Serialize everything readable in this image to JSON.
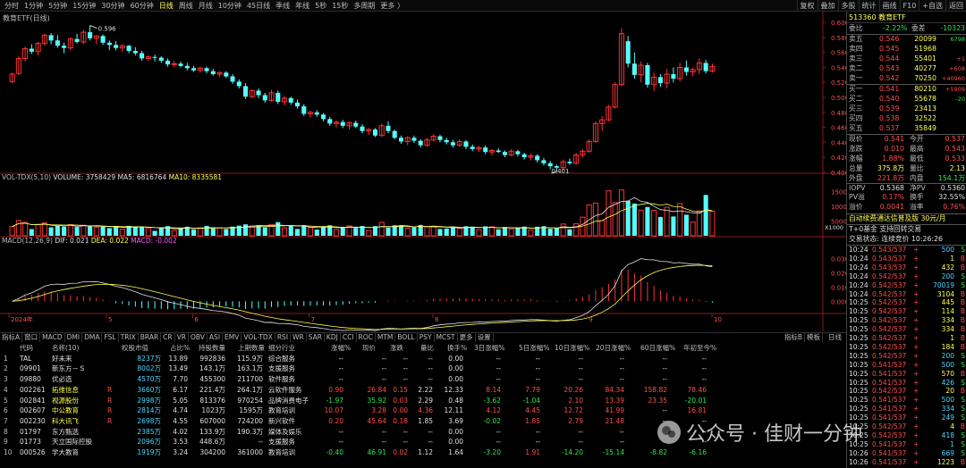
{
  "period_tabs": [
    "分时",
    "1分钟",
    "5分钟",
    "15分钟",
    "30分钟",
    "60分钟",
    "日线",
    "周线",
    "月线",
    "10分钟",
    "45日线",
    "季线",
    "年线",
    "5秒",
    "15秒",
    "多周期",
    "更多 〉"
  ],
  "active_period": "日线",
  "right_tools": [
    "复权",
    "叠加",
    "多股",
    "统计",
    "画线",
    "F10",
    "+自选",
    "返回"
  ],
  "chart_title": "教育ETF(日线)",
  "price_axis": [
    "0.600",
    "0.580",
    "0.560",
    "0.540",
    "0.520",
    "0.500",
    "0.480",
    "0.460",
    "0.440",
    "0.420",
    "0.400"
  ],
  "high_label": "0.596",
  "low_label": "0.401",
  "vol_legend": {
    "name": "VOL-TDX(5,10)",
    "volume": "VOLUME: 3758429",
    "ma5": "MA5: 6816764",
    "ma10": "MA10: 8335581"
  },
  "vol_axis": [
    "15000",
    "10000",
    "5000"
  ],
  "vol_unit": "X1000",
  "macd_legend": {
    "name": "MACD(12,26,9)",
    "dif": "DIF: 0.021",
    "dea": "DEA: 0.022",
    "macd": "MACD: -0.002"
  },
  "macd_axis": [
    "0.030",
    "0.020",
    "0.010",
    "0.000"
  ],
  "date_axis": [
    "2024年",
    "5",
    "6",
    "7",
    "8",
    "9",
    "10"
  ],
  "indicator_tabs": [
    "指标A",
    "窗口",
    "MACD",
    "DMI",
    "DMA",
    "FSL",
    "TRIX",
    "BRAR",
    "CR",
    "VR",
    "OBV",
    "ASI",
    "EMV",
    "VOL-TDX",
    "RSI",
    "WR",
    "SAR",
    "KDJ",
    "CCI",
    "ROC",
    "MTM",
    "BOLL",
    "PSY",
    "MCST",
    "更多",
    "设置"
  ],
  "indicator_right": [
    "指标B",
    "模板"
  ],
  "day_line_label": "日线",
  "table_headers": [
    "代码",
    "名称(10)",
    "",
    "权股市值",
    "占比%",
    "持股数量",
    "上期数量",
    "细分行业",
    "涨幅%",
    "现价",
    "涨跌",
    "量比",
    "换手%",
    "3日涨幅%",
    "5日涨幅%",
    "10日涨幅%",
    "20日涨幅%",
    "60日涨幅%",
    "年初至今%"
  ],
  "table_rows": [
    {
      "idx": "1",
      "code": "TAL",
      "name": "好未来",
      "r": "",
      "mv": "8237万",
      "pct": "13.89",
      "hold": "992836",
      "prev": "115.9万",
      "ind": "综合服务",
      "chg": "--",
      "price": "--",
      "diff": "--",
      "vr": "--",
      "to": "0.00",
      "d3": "--",
      "d5": "--",
      "d10": "--",
      "d20": "--",
      "d60": "--",
      "ytd": "--",
      "color": "white"
    },
    {
      "idx": "2",
      "code": "09901",
      "name": "新东方－Ｓ",
      "r": "",
      "mv": "8002万",
      "pct": "13.49",
      "hold": "143.1万",
      "prev": "163.1万",
      "ind": "支援服务",
      "chg": "--",
      "price": "--",
      "diff": "--",
      "vr": "--",
      "to": "0.00",
      "d3": "--",
      "d5": "--",
      "d10": "--",
      "d20": "--",
      "d60": "--",
      "ytd": "--",
      "color": "white"
    },
    {
      "idx": "3",
      "code": "09880",
      "name": "优必选",
      "r": "",
      "mv": "4570万",
      "pct": "7.70",
      "hold": "455300",
      "prev": "211700",
      "ind": "软件服务",
      "chg": "--",
      "price": "--",
      "diff": "--",
      "vr": "--",
      "to": "0.00",
      "d3": "--",
      "d5": "--",
      "d10": "--",
      "d20": "--",
      "d60": "--",
      "ytd": "--",
      "color": "white"
    },
    {
      "idx": "4",
      "code": "002261",
      "name": "拓维信息",
      "r": "R",
      "mv": "3660万",
      "pct": "6.17",
      "hold": "221.4万",
      "prev": "264.1万",
      "ind": "云软件服务",
      "chg": "0.90",
      "price": "26.84",
      "diff": "0.15",
      "vr": "2.22",
      "to": "12.33",
      "d3": "8.14",
      "d5": "7.79",
      "d10": "20.26",
      "d20": "84.34",
      "d60": "158.82",
      "ytd": "78.46",
      "color": "red"
    },
    {
      "idx": "5",
      "code": "002841",
      "name": "视源股份",
      "r": "R",
      "mv": "2998万",
      "pct": "5.05",
      "hold": "813376",
      "prev": "970254",
      "ind": "品牌消费电子",
      "chg": "-1.97",
      "price": "35.92",
      "diff": "0.03",
      "vr": "2.29",
      "to": "0.48",
      "d3": "-3.62",
      "d5": "-1.04",
      "d10": "2.10",
      "d20": "13.39",
      "d60": "23.35",
      "ytd": "-20.01",
      "color": "green"
    },
    {
      "idx": "6",
      "code": "002607",
      "name": "中公教育",
      "r": "R",
      "mv": "2814万",
      "pct": "4.74",
      "hold": "1023万",
      "prev": "1595万",
      "ind": "教育培训",
      "chg": "10.07",
      "price": "3.28",
      "diff": "0.00",
      "vr": "4.36",
      "to": "12.11",
      "d3": "4.12",
      "d5": "4.45",
      "d10": "12.72",
      "d20": "41.99",
      "d60": "--",
      "ytd": "16.81",
      "color": "red"
    },
    {
      "idx": "7",
      "code": "002230",
      "name": "科大讯飞",
      "r": "R",
      "mv": "2698万",
      "pct": "4.55",
      "hold": "607000",
      "prev": "724200",
      "ind": "新兴软件",
      "chg": "0.20",
      "price": "45.64",
      "diff": "0.18",
      "vr": "1.85",
      "to": "3.69",
      "d3": "-0.02",
      "d5": "1.85",
      "d10": "2.79",
      "d20": "21.48",
      "d60": "--",
      "ytd": "--",
      "color": "red"
    },
    {
      "idx": "8",
      "code": "01797",
      "name": "东方甄选",
      "r": "",
      "mv": "2385万",
      "pct": "4.02",
      "hold": "133.9万",
      "prev": "190.3万",
      "ind": "媒体及娱乐",
      "chg": "--",
      "price": "--",
      "diff": "--",
      "vr": "--",
      "to": "0.00",
      "d3": "--",
      "d5": "--",
      "d10": "--",
      "d20": "--",
      "d60": "--",
      "ytd": "--",
      "color": "white"
    },
    {
      "idx": "9",
      "code": "01773",
      "name": "天立国际控股",
      "r": "",
      "mv": "2096万",
      "pct": "3.53",
      "hold": "448.6万",
      "prev": "--",
      "ind": "支援服务",
      "chg": "--",
      "price": "--",
      "diff": "--",
      "vr": "--",
      "to": "0.00",
      "d3": "--",
      "d5": "--",
      "d10": "--",
      "d20": "--",
      "d60": "--",
      "ytd": "--",
      "color": "white"
    },
    {
      "idx": "10",
      "code": "000526",
      "name": "学大教育",
      "r": "",
      "mv": "1919万",
      "pct": "3.24",
      "hold": "304200",
      "prev": "361000",
      "ind": "教育培训",
      "chg": "-0.40",
      "price": "46.91",
      "diff": "0.02",
      "vr": "1.12",
      "to": "1.64",
      "d3": "-3.20",
      "d5": "1.91",
      "d10": "-14.20",
      "d20": "-15.14",
      "d60": "-8.82",
      "ytd": "-6.16",
      "color": "green"
    }
  ],
  "right_panel": {
    "code_name": "513360 教育ETF",
    "weibi_label": "委比",
    "weibi_val": "-2.22%",
    "weicha_label": "委差",
    "weicha_val": "-10323",
    "asks": [
      {
        "label": "卖五",
        "price": "0.546",
        "vol": "20099",
        "chg": "6798"
      },
      {
        "label": "卖四",
        "price": "0.545",
        "vol": "51968",
        "chg": ""
      },
      {
        "label": "卖三",
        "price": "0.544",
        "vol": "55401",
        "chg": "+1"
      },
      {
        "label": "卖二",
        "price": "0.543",
        "vol": "40277",
        "chg": "+608"
      },
      {
        "label": "卖一",
        "price": "0.542",
        "vol": "70250",
        "chg": "+40960"
      }
    ],
    "bids": [
      {
        "label": "买一",
        "price": "0.541",
        "vol": "80210",
        "chg": "+5909"
      },
      {
        "label": "买二",
        "price": "0.540",
        "vol": "55678",
        "chg": "-20"
      },
      {
        "label": "买三",
        "price": "0.539",
        "vol": "23413",
        "chg": ""
      },
      {
        "label": "买四",
        "price": "0.538",
        "vol": "32522",
        "chg": ""
      },
      {
        "label": "买五",
        "price": "0.537",
        "vol": "35849",
        "chg": ""
      }
    ],
    "quote": [
      {
        "l1": "现价",
        "v1": "0.541",
        "c1": "red",
        "l2": "今开",
        "v2": "0.537",
        "c2": "red"
      },
      {
        "l1": "涨跌",
        "v1": "0.010",
        "c1": "red",
        "l2": "最高",
        "v2": "0.543",
        "c2": "red"
      },
      {
        "l1": "涨幅",
        "v1": "1.88%",
        "c1": "red",
        "l2": "最低",
        "v2": "0.533",
        "c2": "red"
      },
      {
        "l1": "总量",
        "v1": "375.8万",
        "c1": "yellow",
        "l2": "量比",
        "v2": "2.13",
        "c2": "yellow"
      },
      {
        "l1": "外盘",
        "v1": "221.8万",
        "c1": "red",
        "l2": "内盘",
        "v2": "154.1万",
        "c2": "green"
      },
      {
        "l1": "IOPV",
        "v1": "0.5368",
        "c1": "white",
        "l2": "净PV",
        "v2": "0.5360",
        "c2": "white"
      },
      {
        "l1": "PV溢",
        "v1": "0.17%",
        "c1": "red",
        "l2": "换手",
        "v2": "32.55%",
        "c2": "white"
      },
      {
        "l1": "溢价",
        "v1": "0.0041",
        "c1": "red",
        "l2": "溢率",
        "v2": "0.76%",
        "c2": "red"
      }
    ],
    "notice1": "自动续费通达信普及版 30元/月",
    "notice2": "T+0基金 支持回转交易",
    "notice3": "交易状态: 连续竞价 10:26:26",
    "ticks": [
      {
        "t": "10:24",
        "p": "0.543/537",
        "v": "500",
        "s": "S"
      },
      {
        "t": "10:24",
        "p": "0.543/537",
        "v": "1",
        "s": "B"
      },
      {
        "t": "10:24",
        "p": "0.543/537",
        "v": "432",
        "s": "B"
      },
      {
        "t": "10:24",
        "p": "0.542/537",
        "v": "200",
        "s": "S"
      },
      {
        "t": "10:24",
        "p": "0.542/537",
        "v": "70019",
        "s": "S"
      },
      {
        "t": "10:24",
        "p": "0.542/537",
        "v": "3104",
        "s": "B"
      },
      {
        "t": "10:25",
        "p": "0.542/537",
        "v": "445",
        "s": "B"
      },
      {
        "t": "10:25",
        "p": "0.542/537",
        "v": "114",
        "s": "B"
      },
      {
        "t": "10:25",
        "p": "0.542/537",
        "v": "334",
        "s": "B"
      },
      {
        "t": "10:25",
        "p": "0.542/537",
        "v": "334",
        "s": "B"
      },
      {
        "t": "10:25",
        "p": "0.542/537",
        "v": "1",
        "s": "B"
      },
      {
        "t": "10:25",
        "p": "0.542/537",
        "v": "184",
        "s": "B"
      },
      {
        "t": "10:25",
        "p": "0.542/537",
        "v": "200",
        "s": "S"
      },
      {
        "t": "10:25",
        "p": "0.541/537",
        "v": "500",
        "s": "S"
      },
      {
        "t": "10:25",
        "p": "0.541/537",
        "v": "570",
        "s": "B"
      },
      {
        "t": "10:25",
        "p": "0.541/537",
        "v": "426",
        "s": "S"
      },
      {
        "t": "10:25",
        "p": "0.542/537",
        "v": "20",
        "s": "B"
      },
      {
        "t": "10:25",
        "p": "0.541/537",
        "v": "500",
        "s": "S"
      },
      {
        "t": "10:25",
        "p": "0.541/537",
        "v": "334",
        "s": "S"
      },
      {
        "t": "10:25",
        "p": "0.541/537",
        "v": "249",
        "s": "S"
      },
      {
        "t": "10:25",
        "p": "0.542/537",
        "v": "4",
        "s": "B"
      },
      {
        "t": "10:25",
        "p": "0.542/537",
        "v": "418",
        "s": "S"
      },
      {
        "t": "10:25",
        "p": "0.541/537",
        "v": "1",
        "s": "S"
      },
      {
        "t": "10:26",
        "p": "0.541/537",
        "v": "669",
        "s": "S"
      },
      {
        "t": "10:26",
        "p": "0.541/537",
        "v": "1223",
        "s": "B"
      }
    ]
  },
  "watermark": "公众号 · 佳财一分钟",
  "chart_data": {
    "type": "candlestick",
    "title": "教育ETF(日线)",
    "ylim": [
      0.395,
      0.605
    ],
    "values": [
      [
        0.521,
        0.533,
        0.519,
        0.531
      ],
      [
        0.532,
        0.555,
        0.53,
        0.552
      ],
      [
        0.552,
        0.568,
        0.548,
        0.565
      ],
      [
        0.565,
        0.571,
        0.558,
        0.561
      ],
      [
        0.561,
        0.574,
        0.556,
        0.572
      ],
      [
        0.572,
        0.585,
        0.569,
        0.583
      ],
      [
        0.583,
        0.586,
        0.571,
        0.576
      ],
      [
        0.576,
        0.583,
        0.566,
        0.569
      ],
      [
        0.569,
        0.573,
        0.559,
        0.566
      ],
      [
        0.566,
        0.58,
        0.563,
        0.578
      ],
      [
        0.578,
        0.585,
        0.572,
        0.574
      ],
      [
        0.574,
        0.59,
        0.571,
        0.587
      ],
      [
        0.587,
        0.596,
        0.576,
        0.579
      ],
      [
        0.579,
        0.583,
        0.571,
        0.582
      ],
      [
        0.582,
        0.584,
        0.57,
        0.573
      ],
      [
        0.573,
        0.576,
        0.563,
        0.57
      ],
      [
        0.57,
        0.575,
        0.563,
        0.566
      ],
      [
        0.566,
        0.571,
        0.561,
        0.569
      ],
      [
        0.569,
        0.57,
        0.559,
        0.562
      ],
      [
        0.562,
        0.567,
        0.556,
        0.559
      ],
      [
        0.559,
        0.562,
        0.549,
        0.552
      ],
      [
        0.552,
        0.556,
        0.549,
        0.554
      ],
      [
        0.554,
        0.557,
        0.548,
        0.553
      ],
      [
        0.553,
        0.555,
        0.546,
        0.549
      ],
      [
        0.549,
        0.552,
        0.541,
        0.544
      ],
      [
        0.544,
        0.549,
        0.54,
        0.545
      ],
      [
        0.545,
        0.548,
        0.54,
        0.542
      ],
      [
        0.542,
        0.546,
        0.536,
        0.539
      ],
      [
        0.539,
        0.542,
        0.534,
        0.536
      ],
      [
        0.536,
        0.541,
        0.533,
        0.539
      ],
      [
        0.539,
        0.541,
        0.532,
        0.535
      ],
      [
        0.535,
        0.538,
        0.529,
        0.531
      ],
      [
        0.531,
        0.535,
        0.527,
        0.533
      ],
      [
        0.533,
        0.535,
        0.526,
        0.528
      ],
      [
        0.528,
        0.531,
        0.518,
        0.521
      ],
      [
        0.521,
        0.524,
        0.512,
        0.515
      ],
      [
        0.515,
        0.519,
        0.498,
        0.501
      ],
      [
        0.501,
        0.511,
        0.499,
        0.509
      ],
      [
        0.509,
        0.512,
        0.499,
        0.503
      ],
      [
        0.503,
        0.506,
        0.493,
        0.496
      ],
      [
        0.496,
        0.51,
        0.494,
        0.506
      ],
      [
        0.506,
        0.509,
        0.491,
        0.494
      ],
      [
        0.494,
        0.502,
        0.489,
        0.499
      ],
      [
        0.499,
        0.501,
        0.49,
        0.493
      ],
      [
        0.493,
        0.497,
        0.485,
        0.488
      ],
      [
        0.488,
        0.491,
        0.475,
        0.478
      ],
      [
        0.478,
        0.482,
        0.473,
        0.48
      ],
      [
        0.48,
        0.483,
        0.474,
        0.477
      ],
      [
        0.477,
        0.479,
        0.468,
        0.471
      ],
      [
        0.471,
        0.474,
        0.462,
        0.465
      ],
      [
        0.465,
        0.469,
        0.46,
        0.467
      ],
      [
        0.467,
        0.47,
        0.459,
        0.462
      ],
      [
        0.462,
        0.468,
        0.457,
        0.466
      ],
      [
        0.466,
        0.469,
        0.459,
        0.461
      ],
      [
        0.461,
        0.464,
        0.452,
        0.455
      ],
      [
        0.455,
        0.459,
        0.45,
        0.457
      ],
      [
        0.457,
        0.459,
        0.447,
        0.449
      ],
      [
        0.449,
        0.465,
        0.447,
        0.462
      ],
      [
        0.462,
        0.468,
        0.452,
        0.455
      ],
      [
        0.455,
        0.457,
        0.444,
        0.446
      ],
      [
        0.446,
        0.449,
        0.438,
        0.441
      ],
      [
        0.441,
        0.448,
        0.436,
        0.446
      ],
      [
        0.446,
        0.449,
        0.439,
        0.442
      ],
      [
        0.442,
        0.444,
        0.433,
        0.436
      ],
      [
        0.436,
        0.446,
        0.434,
        0.443
      ],
      [
        0.443,
        0.451,
        0.441,
        0.448
      ],
      [
        0.448,
        0.45,
        0.44,
        0.443
      ],
      [
        0.443,
        0.446,
        0.437,
        0.44
      ],
      [
        0.44,
        0.443,
        0.433,
        0.436
      ],
      [
        0.436,
        0.444,
        0.434,
        0.441
      ],
      [
        0.441,
        0.443,
        0.431,
        0.434
      ],
      [
        0.434,
        0.437,
        0.428,
        0.431
      ],
      [
        0.431,
        0.435,
        0.427,
        0.433
      ],
      [
        0.433,
        0.436,
        0.424,
        0.427
      ],
      [
        0.427,
        0.431,
        0.422,
        0.429
      ],
      [
        0.429,
        0.432,
        0.426,
        0.427
      ],
      [
        0.427,
        0.429,
        0.42,
        0.423
      ],
      [
        0.423,
        0.431,
        0.421,
        0.428
      ],
      [
        0.428,
        0.43,
        0.421,
        0.424
      ],
      [
        0.424,
        0.426,
        0.417,
        0.42
      ],
      [
        0.42,
        0.425,
        0.416,
        0.422
      ],
      [
        0.422,
        0.424,
        0.413,
        0.416
      ],
      [
        0.416,
        0.419,
        0.409,
        0.412
      ],
      [
        0.412,
        0.415,
        0.404,
        0.408
      ],
      [
        0.408,
        0.41,
        0.401,
        0.406
      ],
      [
        0.406,
        0.417,
        0.403,
        0.414
      ],
      [
        0.414,
        0.418,
        0.41,
        0.412
      ],
      [
        0.412,
        0.426,
        0.41,
        0.423
      ],
      [
        0.423,
        0.431,
        0.419,
        0.428
      ],
      [
        0.428,
        0.444,
        0.426,
        0.441
      ],
      [
        0.441,
        0.468,
        0.439,
        0.465
      ],
      [
        0.465,
        0.475,
        0.455,
        0.47
      ],
      [
        0.47,
        0.49,
        0.468,
        0.487
      ],
      [
        0.487,
        0.52,
        0.485,
        0.517
      ],
      [
        0.517,
        0.592,
        0.515,
        0.585
      ],
      [
        0.575,
        0.582,
        0.54,
        0.545
      ],
      [
        0.545,
        0.56,
        0.525,
        0.53
      ],
      [
        0.53,
        0.548,
        0.52,
        0.543
      ],
      [
        0.543,
        0.546,
        0.513,
        0.517
      ],
      [
        0.517,
        0.533,
        0.508,
        0.527
      ],
      [
        0.527,
        0.531,
        0.514,
        0.519
      ],
      [
        0.519,
        0.538,
        0.512,
        0.531
      ],
      [
        0.531,
        0.54,
        0.52,
        0.525
      ],
      [
        0.525,
        0.546,
        0.521,
        0.54
      ],
      [
        0.54,
        0.549,
        0.529,
        0.534
      ],
      [
        0.534,
        0.54,
        0.528,
        0.537
      ],
      [
        0.537,
        0.552,
        0.531,
        0.546
      ],
      [
        0.546,
        0.55,
        0.532,
        0.535
      ],
      [
        0.535,
        0.545,
        0.533,
        0.541
      ]
    ],
    "volume_ylim": [
      0,
      16000
    ],
    "macd_ylim": [
      -0.008,
      0.036
    ]
  }
}
